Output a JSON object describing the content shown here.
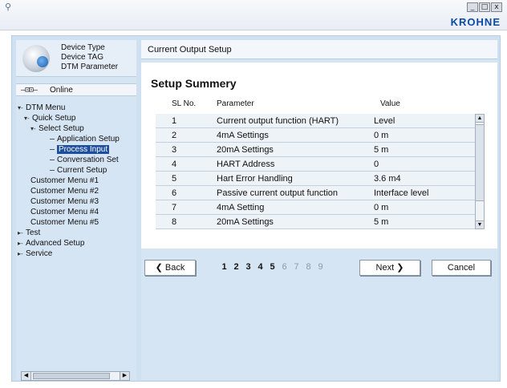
{
  "brand": "KROHNE",
  "window_buttons": [
    "_",
    "□",
    "x"
  ],
  "device": {
    "type": "Device Type",
    "tag": "Device TAG",
    "dtm": "DTM Parameter"
  },
  "online": {
    "plug": "—⊡⊡—",
    "label": "Online"
  },
  "tree": [
    {
      "label": "DTM Menu",
      "toggle": "▾-",
      "level": 0
    },
    {
      "label": "Quick Setup",
      "toggle": "▾-",
      "level": 1
    },
    {
      "label": "Select Setup",
      "toggle": "▾-",
      "level": 2
    },
    {
      "label": "Application Setup",
      "toggle": "",
      "level": 3
    },
    {
      "label": "Process Input",
      "toggle": "",
      "level": 3,
      "selected": true
    },
    {
      "label": "Conversation Set",
      "toggle": "",
      "level": 3
    },
    {
      "label": "Current Setup",
      "toggle": "",
      "level": 3
    },
    {
      "label": "Customer Menu #1",
      "toggle": "",
      "level": 2
    },
    {
      "label": "Customer Menu #2",
      "toggle": "",
      "level": 2
    },
    {
      "label": "Customer Menu #3",
      "toggle": "",
      "level": 2
    },
    {
      "label": "Customer Menu #4",
      "toggle": "",
      "level": 2
    },
    {
      "label": "Customer Menu #5",
      "toggle": "",
      "level": 2
    },
    {
      "label": "Test",
      "toggle": "▸-",
      "level": 0
    },
    {
      "label": "Advanced Setup",
      "toggle": "▸-",
      "level": 0
    },
    {
      "label": "Service",
      "toggle": "▸-",
      "level": 0
    }
  ],
  "main": {
    "header": "Current Output Setup",
    "section_title": "Setup Summery",
    "columns": {
      "sl": "SL No.",
      "param": "Parameter",
      "value": "Value"
    },
    "rows": [
      {
        "sl": "1",
        "param": "Current output function (HART)",
        "value": "Level"
      },
      {
        "sl": "2",
        "param": "4mA  Settings",
        "value": "0 m"
      },
      {
        "sl": "3",
        "param": "20mA Settings",
        "value": "5 m"
      },
      {
        "sl": "4",
        "param": "HART Address",
        "value": "0"
      },
      {
        "sl": "5",
        "param": "Hart Error Handling",
        "value": "3.6 m4"
      },
      {
        "sl": "6",
        "param": "Passive current output function",
        "value": "Interface level"
      },
      {
        "sl": "7",
        "param": "4mA Setting",
        "value": "0 m"
      },
      {
        "sl": "8",
        "param": "20mA Settings",
        "value": "5 m"
      }
    ],
    "back_label": "❮ Back",
    "pages": [
      "1",
      "2",
      "3",
      "4",
      "5",
      "6",
      "7",
      "8",
      "9"
    ],
    "active_pages": 5,
    "next_label": "Next ❯",
    "cancel_label": "Cancel"
  }
}
